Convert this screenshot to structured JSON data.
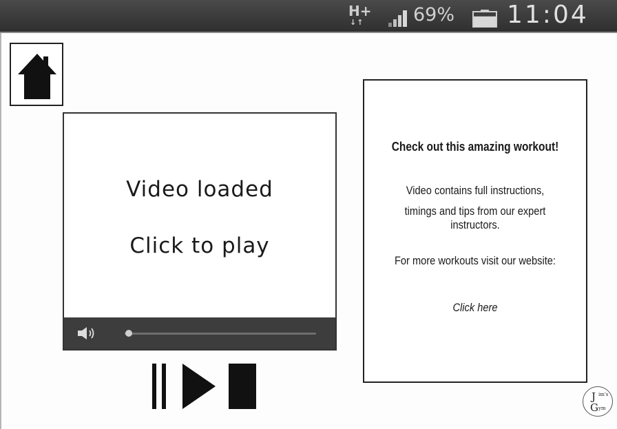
{
  "status_bar": {
    "network_type": "H+",
    "network_arrows": "↓↑",
    "battery_percent": "69%",
    "battery_level": 0.69,
    "time": "11:04"
  },
  "home": {
    "icon": "home-icon"
  },
  "video": {
    "line1": "Video loaded",
    "line2": "Click to play",
    "progress": 0.0,
    "volume_icon": "speaker-icon"
  },
  "playback": {
    "pause_icon": "pause-icon",
    "play_icon": "play-icon",
    "stop_icon": "stop-icon"
  },
  "info": {
    "headline": "Check out this amazing workout!",
    "body_line1": "Video contains full instructions,",
    "body_line2": "timings and tips from our expert instructors.",
    "prompt": "For more workouts visit our website:",
    "link_text": "Click here"
  },
  "logo": {
    "line1": "J",
    "line1_small": "im's",
    "line2": "G",
    "line2_small": "ym"
  }
}
